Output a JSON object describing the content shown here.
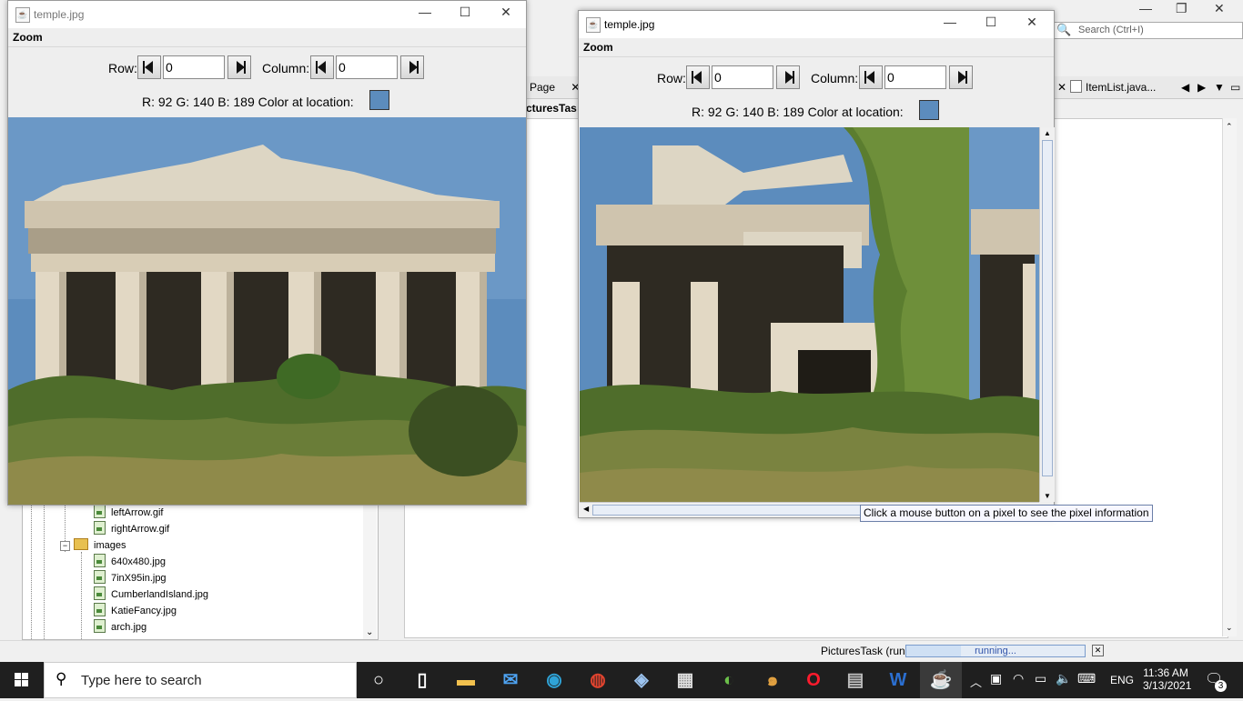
{
  "ide": {
    "search_placeholder": "Search (Ctrl+I)",
    "tabs": [
      {
        "label": "Page",
        "close": "✕"
      },
      {
        "label": "ItemList.java...",
        "close": "✕"
      }
    ],
    "editor_partial_label": "cturesTas",
    "tree": {
      "items": [
        {
          "label": "leftArrow.gif",
          "type": "file"
        },
        {
          "label": "rightArrow.gif",
          "type": "file"
        },
        {
          "label": "images",
          "type": "folder"
        },
        {
          "label": "640x480.jpg",
          "type": "file"
        },
        {
          "label": "7inX95in.jpg",
          "type": "file"
        },
        {
          "label": "CumberlandIsland.jpg",
          "type": "file"
        },
        {
          "label": "KatieFancy.jpg",
          "type": "file"
        },
        {
          "label": "arch.jpg",
          "type": "file"
        }
      ]
    },
    "status": {
      "task": "PicturesTask (run)",
      "progress_text": "running..."
    }
  },
  "windows": [
    {
      "title": "temple.jpg",
      "menu": "Zoom",
      "row_label": "Row:",
      "row_value": "0",
      "column_label": "Column:",
      "column_value": "0",
      "rgb_text": "R: 92 G: 140 B: 189 Color at location:",
      "swatch_color": "#5c8cbd"
    },
    {
      "title": "temple.jpg",
      "menu": "Zoom",
      "row_label": "Row:",
      "row_value": "0",
      "column_label": "Column:",
      "column_value": "0",
      "rgb_text": "R: 92 G: 140 B: 189 Color at location:",
      "swatch_color": "#5c8cbd",
      "tooltip": "Click a mouse button on a pixel to see the pixel information"
    }
  ],
  "taskbar": {
    "search_placeholder": "Type here to search",
    "language": "ENG",
    "time": "11:36 AM",
    "date": "3/13/2021",
    "notifications": "3",
    "apps": [
      "cortana-icon",
      "task-view-icon",
      "file-explorer-icon",
      "mail-icon",
      "edge-icon",
      "chrome-icon",
      "virtualbox-icon",
      "store-icon",
      "color-app-icon",
      "swirl-app-icon",
      "opera-icon",
      "network-app-icon",
      "word-icon",
      "java-icon"
    ]
  }
}
